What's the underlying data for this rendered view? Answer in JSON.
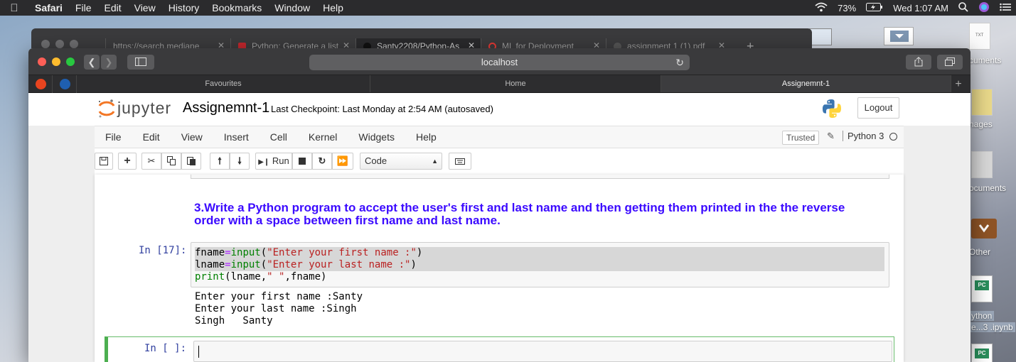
{
  "mac_menubar": {
    "app": "Safari",
    "items": [
      "File",
      "Edit",
      "View",
      "History",
      "Bookmarks",
      "Window",
      "Help"
    ],
    "battery": "73%",
    "clock": "Wed 1:07 AM"
  },
  "background_tabs": [
    {
      "title": "https://search.mediane"
    },
    {
      "title": "Python: Generate a list"
    },
    {
      "title": "Santy2208/Python-As"
    },
    {
      "title": "ML for Deployment"
    },
    {
      "title": "assignment 1 (1).pdf"
    }
  ],
  "browser": {
    "url": "localhost",
    "fav_tabs": [
      "Favourites",
      "Home",
      "Assignemnt-1"
    ]
  },
  "desktop": {
    "labels": [
      "cuments",
      "nages",
      "ocuments",
      "Other",
      "ython",
      "e...3 .ipynb"
    ],
    "doc_tag": "TXT",
    "pc_badge": "PC"
  },
  "jupyter": {
    "logo_text": "jupyter",
    "notebook_name": "Assignemnt-1",
    "checkpoint": "Last Checkpoint: Last Monday at 2:54 AM  (autosaved)",
    "logout": "Logout",
    "menu": [
      "File",
      "Edit",
      "View",
      "Insert",
      "Cell",
      "Kernel",
      "Widgets",
      "Help"
    ],
    "trusted": "Trusted",
    "kernel": "Python 3",
    "toolbar": {
      "run_label": "Run",
      "cell_type": "Code"
    },
    "markdown_cell": "3.Write a Python program to accept the user's first and last name and then getting them printed in the the reverse order with a space between first name and last name.",
    "code_cell": {
      "prompt": "In [17]:",
      "lines": [
        {
          "var": "fname",
          "op": "=",
          "fn": "input",
          "open": "(",
          "str": "\"Enter your first name :\"",
          "close": ")"
        },
        {
          "var": "lname",
          "op": "=",
          "fn": "input",
          "open": "(",
          "str": "\"Enter your last name :\"",
          "close": ")"
        },
        {
          "fn": "print",
          "a": "(lname,",
          "str": "\" \"",
          "b": ",fname)"
        }
      ],
      "output": "Enter your first name :Santy\nEnter your last name :Singh\nSingh   Santy"
    },
    "empty_cell": {
      "prompt": "In [ ]:"
    }
  }
}
